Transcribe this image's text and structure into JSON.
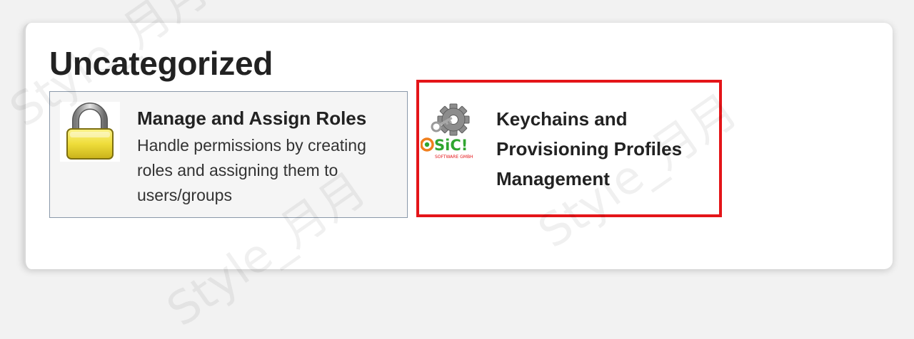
{
  "section": {
    "title": "Uncategorized"
  },
  "cards": [
    {
      "title": "Manage and Assign Roles",
      "description": "Handle permissions by creating roles and assigning them to users/groups",
      "icon": "padlock-icon"
    },
    {
      "title": "Keychains and Provisioning Profiles Management",
      "icon": "gear-key-sic-logo-icon",
      "logo_text": "SiC!",
      "logo_subtext": "SOFTWARE GMBH"
    }
  ],
  "colors": {
    "highlight_border": "#e41519",
    "card_border": "#8a99aa",
    "card_bg": "#f5f5f5",
    "lock_yellow": "#f2e24a",
    "logo_green": "#2fa52f",
    "logo_orange": "#f07f1d"
  },
  "watermark": "Style_月月"
}
